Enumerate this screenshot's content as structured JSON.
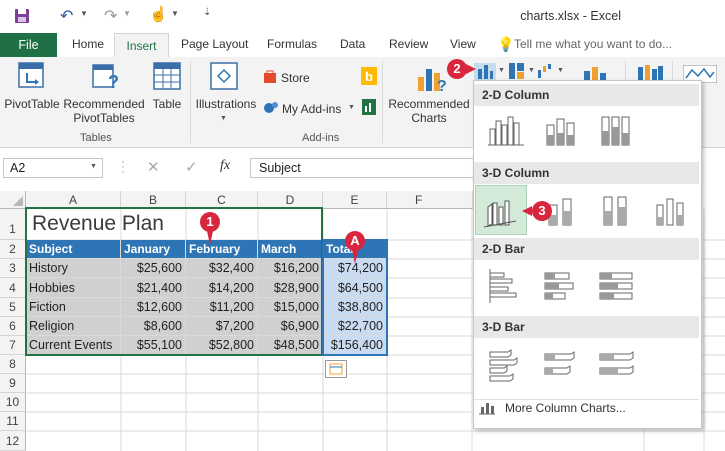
{
  "window": {
    "title": "charts.xlsx - Excel"
  },
  "tabs": [
    "File",
    "Home",
    "Insert",
    "Page Layout",
    "Formulas",
    "Data",
    "Review",
    "View"
  ],
  "tell_me": "Tell me what you want to do...",
  "ribbon": {
    "pivottable": "PivotTable",
    "recommended_pivottables_1": "Recommended",
    "recommended_pivottables_2": "PivotTables",
    "table": "Table",
    "tables_group": "Tables",
    "illustrations": "Illustrations",
    "store": "Store",
    "my_addins": "My Add-ins",
    "addins_group": "Add-ins",
    "recommended_charts_1": "Recommended",
    "recommended_charts_2": "Charts"
  },
  "formula_bar": {
    "name_box": "A2",
    "fx": "fx",
    "content": "Subject"
  },
  "columns": [
    "A",
    "B",
    "C",
    "D",
    "E",
    "F"
  ],
  "rows": [
    "1",
    "2",
    "3",
    "4",
    "5",
    "6",
    "7",
    "8",
    "9",
    "10",
    "11",
    "12"
  ],
  "sheet": {
    "title": "Revenue Plan",
    "headers": [
      "Subject",
      "January",
      "February",
      "March",
      "Total"
    ],
    "data": [
      [
        "History",
        "$25,600",
        "$32,400",
        "$16,200",
        "$74,200"
      ],
      [
        "Hobbies",
        "$21,400",
        "$14,200",
        "$28,900",
        "$64,500"
      ],
      [
        "Fiction",
        "$12,600",
        "$11,200",
        "$15,000",
        "$38,800"
      ],
      [
        "Religion",
        "$8,600",
        "$7,200",
        "$6,900",
        "$22,700"
      ],
      [
        "Current Events",
        "$55,100",
        "$52,800",
        "$48,500",
        "$156,400"
      ]
    ]
  },
  "dropdown": {
    "sections": [
      "2-D Column",
      "3-D Column",
      "2-D Bar",
      "3-D Bar"
    ],
    "more": "More Column Charts..."
  },
  "callouts": {
    "c1": "1",
    "c2": "2",
    "c3": "3",
    "cA": "A"
  },
  "colors": {
    "excel_green": "#1f7145",
    "header_blue": "#2e75b6",
    "callout_red": "#d7263d",
    "total_fill": "#c9dbf1"
  }
}
